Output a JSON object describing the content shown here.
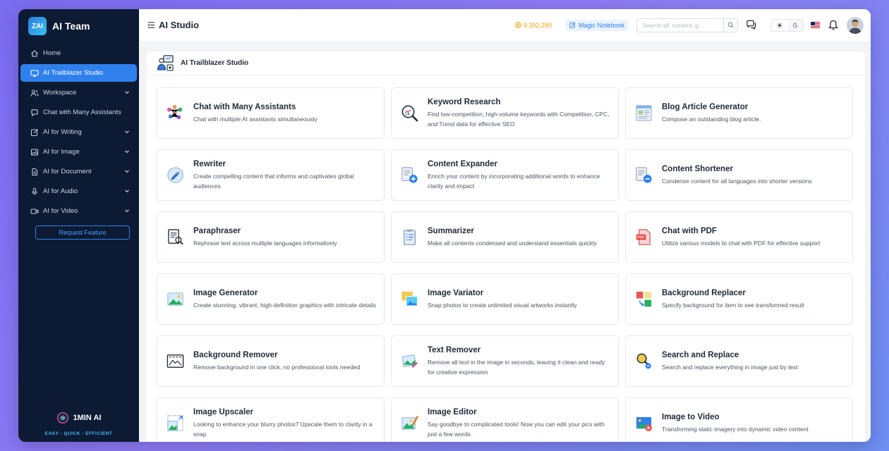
{
  "brand": {
    "logo_text": "ZAI",
    "name": "AI Team"
  },
  "sidebar": {
    "items": [
      {
        "label": "Home",
        "icon": "home-icon",
        "active": false,
        "expandable": false
      },
      {
        "label": "AI Trailblazer Studio",
        "icon": "monitor-icon",
        "active": true,
        "expandable": false
      },
      {
        "label": "Workspace",
        "icon": "users-icon",
        "active": false,
        "expandable": true
      },
      {
        "label": "Chat with Many Assistants",
        "icon": "chat-bubble-icon",
        "active": false,
        "expandable": false
      },
      {
        "label": "AI for Writing",
        "icon": "pencil-square-icon",
        "active": false,
        "expandable": true
      },
      {
        "label": "AI for Image",
        "icon": "image-icon",
        "active": false,
        "expandable": true
      },
      {
        "label": "AI for Document",
        "icon": "document-icon",
        "active": false,
        "expandable": true
      },
      {
        "label": "AI for Audio",
        "icon": "microphone-icon",
        "active": false,
        "expandable": true
      },
      {
        "label": "AI for Video",
        "icon": "video-icon",
        "active": false,
        "expandable": true
      }
    ],
    "request_button": "Request Feature",
    "footer": {
      "name": "1MIN AI",
      "tagline": "EASY - QUICK - EFFICIENT"
    }
  },
  "header": {
    "title": "AI Studio",
    "credits": "9,392,280",
    "notebook_label": "Magic Notebook",
    "search_placeholder": "Search all: content, g..."
  },
  "studio": {
    "title": "AI Trailblazer Studio",
    "cards": [
      {
        "title": "Chat with Many Assistants",
        "desc": "Chat with multiple AI assistants simultaneously",
        "icon": "multi-chat-icon"
      },
      {
        "title": "Keyword Research",
        "desc": "Find low-competition, high-volume keywords with Competition, CPC, and Trend data for effective SEO",
        "icon": "keyword-search-icon"
      },
      {
        "title": "Blog Article Generator",
        "desc": "Compose an outstanding blog article.",
        "icon": "blog-article-icon"
      },
      {
        "title": "Rewriter",
        "desc": "Create compelling content that informs and captivates global audiences",
        "icon": "rewriter-icon"
      },
      {
        "title": "Content Expander",
        "desc": "Enrich your content by incorporating additional words to enhance clarity and impact",
        "icon": "content-expand-icon"
      },
      {
        "title": "Content Shortener",
        "desc": "Condense content for all languages into shorter versions",
        "icon": "content-shorten-icon"
      },
      {
        "title": "Paraphraser",
        "desc": "Rephrase text across multiple languages informatively",
        "icon": "paraphrase-icon"
      },
      {
        "title": "Summarizer",
        "desc": "Make all contents condensed and understand essentials quickly",
        "icon": "summarizer-icon"
      },
      {
        "title": "Chat with PDF",
        "desc": "Utilize various models to chat with PDF for effective support",
        "icon": "pdf-icon"
      },
      {
        "title": "Image Generator",
        "desc": "Create stunning, vibrant, high-definition graphics with intricate details",
        "icon": "image-generator-icon"
      },
      {
        "title": "Image Variator",
        "desc": "Snap photos to create unlimited visual artworks instantly",
        "icon": "image-variator-icon"
      },
      {
        "title": "Background Replacer",
        "desc": "Specify background for item to see transformed result",
        "icon": "background-replace-icon"
      },
      {
        "title": "Background Remover",
        "desc": "Remove background in one click, no professional tools needed",
        "icon": "background-remove-icon"
      },
      {
        "title": "Text Remover",
        "desc": "Remove all text in the image in seconds, leaving it clean and ready for creative expression",
        "icon": "text-remove-icon"
      },
      {
        "title": "Search and Replace",
        "desc": "Search and replace everything in image just by text",
        "icon": "search-replace-icon"
      },
      {
        "title": "Image Upscaler",
        "desc": "Looking to enhance your blurry photos? Upscale them to clarity in a snap",
        "icon": "image-upscale-icon"
      },
      {
        "title": "Image Editor",
        "desc": "Say goodbye to complicated tools! Now you can edit your pics with just a few words",
        "icon": "image-editor-icon"
      },
      {
        "title": "Image to Video",
        "desc": "Transforming static imagery into dynamic video content",
        "icon": "image-to-video-icon"
      }
    ]
  },
  "colors": {
    "sidebar_bg": "#0c1b33",
    "accent": "#2f80ed",
    "credits": "#f29f05"
  }
}
